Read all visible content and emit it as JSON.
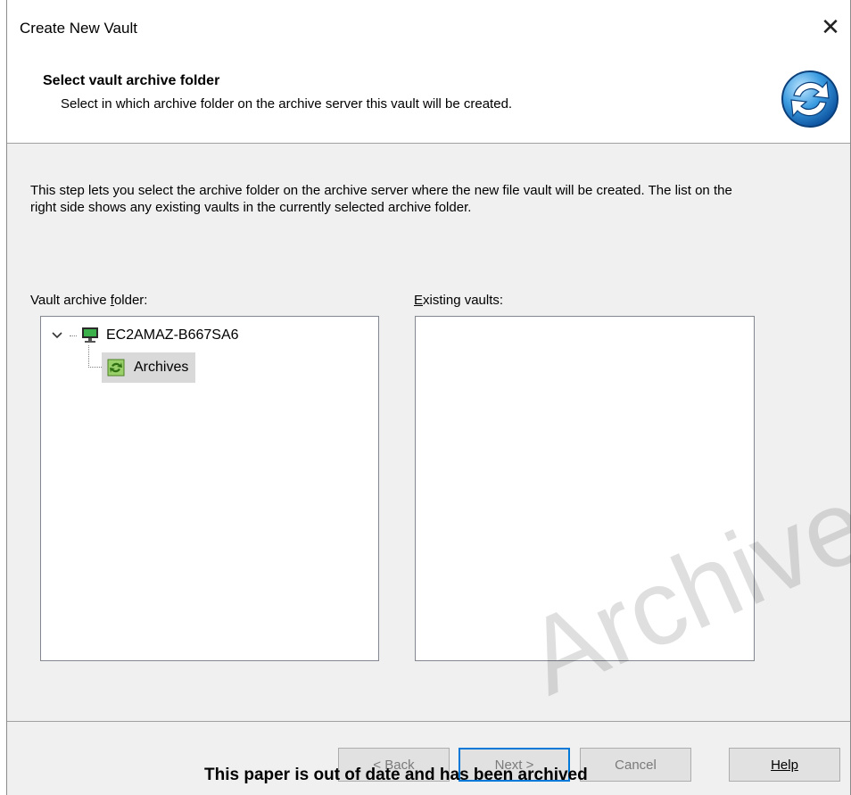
{
  "window": {
    "title": "Create New Vault"
  },
  "header": {
    "title": "Select vault archive folder",
    "subtitle": "Select in which archive folder on the archive server this vault will be created.",
    "icon": "refresh-arrows-icon"
  },
  "body": {
    "description": "This step lets you select the archive folder on the archive server where the new file vault will be created. The list on the right side shows any existing vaults in the currently selected archive folder.",
    "folder_label_pre": "Vault archive ",
    "folder_label_mnemonic": "f",
    "folder_label_post": "older:",
    "vaults_label_mnemonic": "E",
    "vaults_label_post": "xisting vaults:"
  },
  "tree": {
    "server": "EC2AMAZ-B667SA6",
    "folder": "Archives"
  },
  "existing_vaults": [],
  "buttons": {
    "back": "< Back",
    "next": "Next >",
    "cancel": "Cancel",
    "help": "Help"
  },
  "overlay": {
    "watermark": "Archived",
    "note": "This paper is out of date and has been archived"
  },
  "colors": {
    "focus_border": "#0078d7",
    "selection": "#d9d9d9"
  }
}
